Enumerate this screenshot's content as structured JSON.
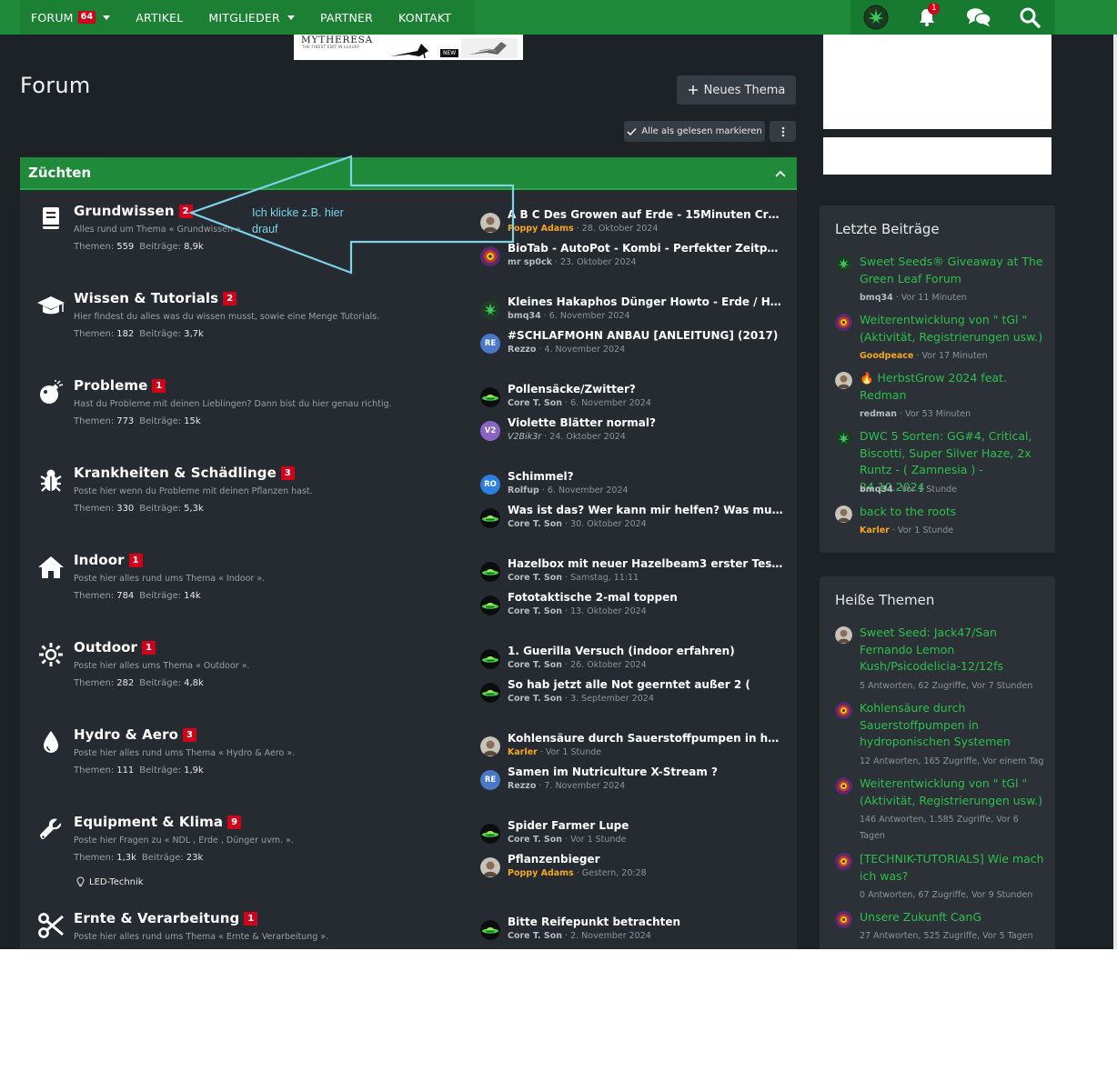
{
  "topbar": {
    "nav": [
      {
        "label": "FORUM",
        "badge": "64",
        "dropdown": true
      },
      {
        "label": "ARTIKEL"
      },
      {
        "label": "MITGLIEDER",
        "dropdown": true
      },
      {
        "label": "PARTNER"
      },
      {
        "label": "KONTAKT"
      }
    ],
    "icons": [
      "cannabis-logo-icon",
      "bell-icon",
      "chat-bubbles-icon",
      "search-icon"
    ],
    "notification_count": "1"
  },
  "ad": {
    "brand": "MYTHERESA",
    "tagline": "THE FINEST EDIT IN LUXURY",
    "new_label": "NEW"
  },
  "page": {
    "title": "Forum",
    "new_thread": "Neues Thema",
    "mark_read": "Alle als gelesen markieren"
  },
  "category": {
    "title": "Züchten",
    "stats_threads_label": "Themen:",
    "stats_posts_label": "Beiträge:",
    "forums": [
      {
        "icon": "book-icon",
        "title": "Grundwissen",
        "badge": "2",
        "desc": "Alles rund um Thema « Grundwissen ».",
        "threads": "559",
        "posts": "8,9k",
        "latest": [
          {
            "title": "A B C Des Growen auf Erde - 15Minuten Crashk...",
            "user": "Poppy Adams",
            "user_style": "gold",
            "date": "28. Oktober 2024",
            "avatar": "photo-avatar"
          },
          {
            "title": "BioTab - AutoPot - Kombi - Perfekter Zeitpunkt ...",
            "user": "mr sp0ck",
            "user_style": "",
            "date": "23. Oktober 2024",
            "avatar": "art-avatar"
          }
        ]
      },
      {
        "icon": "graduation-cap-icon",
        "title": "Wissen & Tutorials",
        "badge": "2",
        "desc": "Hier findest du alles was du wissen musst, sowie eine Menge Tutorials.",
        "threads": "182",
        "posts": "3,7k",
        "latest": [
          {
            "title": "Kleines Hakaphos Dünger Howto - Erde / Hydro ...",
            "user": "bmq34",
            "user_style": "",
            "date": "6. November 2024",
            "avatar": "leaf-avatar"
          },
          {
            "title": "#SCHLAFMOHN ANBAU [ANLEITUNG] (2017)",
            "user": "Rezzo",
            "user_style": "",
            "date": "4. November 2024",
            "avatar": "RE"
          }
        ]
      },
      {
        "icon": "bomb-icon",
        "title": "Probleme",
        "badge": "1",
        "desc": "Hast du Probleme mit deinen Lieblingen? Dann bist du hier genau richtig.",
        "threads": "773",
        "posts": "15k",
        "latest": [
          {
            "title": "Pollensäcke/Zwitter?",
            "user": "Core T. Son",
            "user_style": "",
            "date": "6. November 2024",
            "avatar": "ufo-avatar"
          },
          {
            "title": "Violette Blätter normal?",
            "user": "V2Bik3r",
            "user_style": "italic",
            "date": "24. Oktober 2024",
            "avatar": "V2"
          }
        ]
      },
      {
        "icon": "bug-icon",
        "title": "Krankheiten & Schädlinge",
        "badge": "3",
        "desc": "Poste hier wenn du Probleme mit deinen Pflanzen hast.",
        "threads": "330",
        "posts": "5,3k",
        "latest": [
          {
            "title": "Schimmel?",
            "user": "Rolfup",
            "user_style": "",
            "date": "6. November 2024",
            "avatar": "RO"
          },
          {
            "title": "Was ist das? Wer kann mir helfen? Was muss ic...",
            "user": "Core T. Son",
            "user_style": "",
            "date": "30. Oktober 2024",
            "avatar": "ufo-avatar"
          }
        ]
      },
      {
        "icon": "home-icon",
        "title": "Indoor",
        "badge": "1",
        "desc": "Poste hier alles rund ums Thema « Indoor ».",
        "threads": "784",
        "posts": "14k",
        "latest": [
          {
            "title": "Hazelbox mit neuer Hazelbeam3 erster Test, m...",
            "user": "Core T. Son",
            "user_style": "",
            "date": "Samstag, 11:11",
            "avatar": "ufo-avatar"
          },
          {
            "title": "Fototaktische 2-mal toppen",
            "user": "Core T. Son",
            "user_style": "",
            "date": "13. Oktober 2024",
            "avatar": "ufo-avatar"
          }
        ]
      },
      {
        "icon": "sun-icon",
        "title": "Outdoor",
        "badge": "1",
        "desc": "Poste hier alles ums Thema « Outdoor ».",
        "threads": "282",
        "posts": "4,8k",
        "latest": [
          {
            "title": "1. Guerilla Versuch (indoor erfahren)",
            "user": "Core T. Son",
            "user_style": "",
            "date": "26. Oktober 2024",
            "avatar": "ufo-avatar"
          },
          {
            "title": "So hab jetzt alle Not geerntet außer 2 (",
            "user": "Core T. Son",
            "user_style": "",
            "date": "3. September 2024",
            "avatar": "ufo-avatar"
          }
        ]
      },
      {
        "icon": "water-drop-icon",
        "title": "Hydro & Aero",
        "badge": "3",
        "desc": "Poste hier alles rund ums Thema « Hydro & Aero ».",
        "threads": "111",
        "posts": "1,9k",
        "latest": [
          {
            "title": "Kohlensäure durch Sauerstoffpumpen in hydro...",
            "user": "Karler",
            "user_style": "gold",
            "date": "Vor 1 Stunde",
            "avatar": "photo-avatar"
          },
          {
            "title": "Samen im Nutriculture X-Stream ?",
            "user": "Rezzo",
            "user_style": "",
            "date": "7. November 2024",
            "avatar": "RE"
          }
        ]
      },
      {
        "icon": "wrench-icon",
        "title": "Equipment & Klima",
        "badge": "9",
        "desc": "Poste hier Fragen zu « NDL , Erde , Dünger uvm. ».",
        "threads": "1,3k",
        "posts": "23k",
        "sub": "LED-Technik",
        "latest": [
          {
            "title": "Spider Farmer Lupe",
            "user": "Core T. Son",
            "user_style": "",
            "date": "Vor 1 Stunde",
            "avatar": "ufo-avatar"
          },
          {
            "title": "Pflanzenbieger",
            "user": "Poppy Adams",
            "user_style": "gold",
            "date": "Gestern, 20:28",
            "avatar": "photo-avatar"
          }
        ]
      },
      {
        "icon": "scissors-icon",
        "title": "Ernte & Verarbeitung",
        "badge": "1",
        "desc": "Poste hier alles rund ums Thema « Ernte & Verarbeitung ».",
        "threads": "",
        "posts": "",
        "latest": [
          {
            "title": "Bitte Reifepunkt betrachten",
            "user": "Core T. Son",
            "user_style": "",
            "date": "2. November 2024",
            "avatar": "ufo-avatar"
          }
        ]
      }
    ]
  },
  "annotation": {
    "line1": "Ich klicke z.B. hier",
    "line2": "drauf",
    "color": "#7fd3e8"
  },
  "latest_posts": {
    "title": "Letzte Beiträge",
    "items": [
      {
        "title": "Sweet Seeds® Giveaway at The Green Leaf Forum",
        "user": "bmq34",
        "user_style": "",
        "time": "Vor 11 Minuten",
        "avatar": "leaf-avatar"
      },
      {
        "title": "Weiterentwicklung von \" tGl \" (Aktivität, Registrierungen usw.)",
        "user": "Goodpeace",
        "user_style": "gold",
        "time": "Vor 17 Minuten",
        "avatar": "art-avatar"
      },
      {
        "title": "🔥 HerbstGrow 2024 feat. Redman",
        "user": "redman",
        "user_style": "",
        "time": "Vor 53 Minuten",
        "avatar": "photo-avatar"
      },
      {
        "title": "DWC 5 Sorten: GG#4, Critical, Biscotti, Super Silver Haze, 2x Runtz - ( Zamnesia ) - 24.10.2024",
        "user": "bmq34",
        "user_style": "",
        "time": "Vor 1 Stunde",
        "avatar": "leaf-avatar"
      },
      {
        "title": "back to the roots",
        "user": "Karler",
        "user_style": "gold",
        "time": "Vor 1 Stunde",
        "avatar": "photo-avatar"
      }
    ]
  },
  "hot_threads": {
    "title": "Heiße Themen",
    "items": [
      {
        "title": "Sweet Seed: Jack47/San Fernando Lemon Kush/Psicodelicia-12/12fs",
        "meta": "5 Antworten, 62 Zugriffe, Vor 7 Stunden",
        "avatar": "photo-avatar"
      },
      {
        "title": "Kohlensäure durch Sauerstoffpumpen in hydroponischen Systemen",
        "meta": "12 Antworten, 165 Zugriffe, Vor einem Tag",
        "avatar": "art-avatar"
      },
      {
        "title": "Weiterentwicklung von \" tGl \" (Aktivität, Registrierungen usw.)",
        "meta": "146 Antworten, 1.585 Zugriffe, Vor 6 Tagen",
        "avatar": "art-avatar"
      },
      {
        "title": "[TECHNIK-TUTORIALS] Wie mach ich was?",
        "meta": "0 Antworten, 67 Zugriffe, Vor 9 Stunden",
        "avatar": "art-avatar"
      },
      {
        "title": "Unsere Zukunft CanG",
        "meta": "27 Antworten, 525 Zugriffe, Vor 5 Tagen",
        "avatar": "art-avatar"
      }
    ]
  },
  "colors": {
    "accent": "#1e8a3a",
    "link": "#2fbf4d",
    "badge": "#d0021b",
    "gold_user": "#f5a623",
    "background": "#1d2227"
  }
}
